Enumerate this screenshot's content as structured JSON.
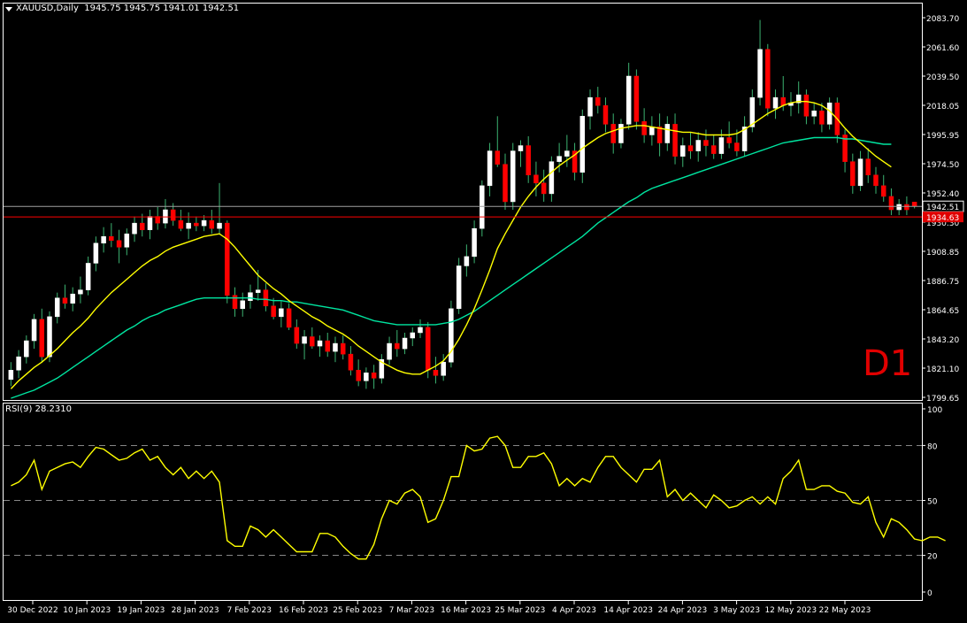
{
  "header": {
    "symbol": "XAUUSD,Daily",
    "ohlc": "1945.75 1945.75 1941.01 1942.51"
  },
  "rsi_label": "RSI(9) 28.2310",
  "timeframe_label": "D1",
  "colors": {
    "background": "#000000",
    "bull": "#ffffff",
    "bear": "#ff0000",
    "ma_fast": "#ffff00",
    "ma_slow": "#00e5a0",
    "rsi": "#ffff00",
    "price_line": "#a0a0a0",
    "red_line": "#ff0000",
    "grid": "#ffffff"
  },
  "price_axis": {
    "ticks": [
      "2083.70",
      "2061.60",
      "2039.50",
      "2018.05",
      "1995.95",
      "1974.50",
      "1952.40",
      "1930.30",
      "1908.85",
      "1886.75",
      "1864.65",
      "1843.20",
      "1821.10",
      "1799.65"
    ],
    "current_price": "1942.51",
    "red_level": "1934.63"
  },
  "rsi_axis": {
    "ticks": [
      "100",
      "80",
      "50",
      "20",
      "0"
    ]
  },
  "date_axis": [
    "30 Dec 2022",
    "10 Jan 2023",
    "19 Jan 2023",
    "28 Jan 2023",
    "7 Feb 2023",
    "16 Feb 2023",
    "25 Feb 2023",
    "7 Mar 2023",
    "16 Mar 2023",
    "25 Mar 2023",
    "4 Apr 2023",
    "14 Apr 2023",
    "24 Apr 2023",
    "3 May 2023",
    "12 May 2023",
    "22 May 2023"
  ],
  "chart_data": [
    {
      "type": "candlestick",
      "title": "XAUUSD,Daily",
      "ylim": [
        1799.65,
        2083.7
      ],
      "candles_ohlc": [
        [
          1813,
          1826,
          1808,
          1820
        ],
        [
          1820,
          1835,
          1814,
          1830
        ],
        [
          1830,
          1846,
          1825,
          1842
        ],
        [
          1842,
          1862,
          1836,
          1858
        ],
        [
          1858,
          1866,
          1826,
          1830
        ],
        [
          1830,
          1864,
          1826,
          1860
        ],
        [
          1860,
          1878,
          1855,
          1874
        ],
        [
          1874,
          1884,
          1866,
          1870
        ],
        [
          1870,
          1882,
          1864,
          1877
        ],
        [
          1877,
          1890,
          1870,
          1880
        ],
        [
          1880,
          1905,
          1876,
          1900
        ],
        [
          1900,
          1920,
          1894,
          1915
        ],
        [
          1915,
          1927,
          1908,
          1920
        ],
        [
          1920,
          1930,
          1912,
          1917
        ],
        [
          1917,
          1925,
          1900,
          1912
        ],
        [
          1912,
          1926,
          1906,
          1922
        ],
        [
          1922,
          1935,
          1916,
          1930
        ],
        [
          1930,
          1937,
          1920,
          1925
        ],
        [
          1925,
          1940,
          1918,
          1935
        ],
        [
          1935,
          1942,
          1925,
          1930
        ],
        [
          1930,
          1948,
          1926,
          1940
        ],
        [
          1940,
          1945,
          1928,
          1932
        ],
        [
          1932,
          1940,
          1924,
          1926
        ],
        [
          1926,
          1938,
          1918,
          1930
        ],
        [
          1930,
          1935,
          1924,
          1928
        ],
        [
          1928,
          1936,
          1924,
          1932
        ],
        [
          1932,
          1940,
          1922,
          1926
        ],
        [
          1926,
          1960,
          1922,
          1930
        ],
        [
          1930,
          1932,
          1870,
          1876
        ],
        [
          1876,
          1882,
          1860,
          1866
        ],
        [
          1866,
          1878,
          1860,
          1872
        ],
        [
          1872,
          1884,
          1866,
          1878
        ],
        [
          1878,
          1895,
          1872,
          1880
        ],
        [
          1880,
          1885,
          1864,
          1868
        ],
        [
          1868,
          1874,
          1858,
          1860
        ],
        [
          1860,
          1872,
          1852,
          1866
        ],
        [
          1866,
          1870,
          1850,
          1852
        ],
        [
          1852,
          1858,
          1836,
          1840
        ],
        [
          1840,
          1850,
          1828,
          1845
        ],
        [
          1845,
          1852,
          1836,
          1838
        ],
        [
          1838,
          1846,
          1830,
          1842
        ],
        [
          1842,
          1848,
          1830,
          1834
        ],
        [
          1834,
          1845,
          1826,
          1840
        ],
        [
          1840,
          1846,
          1828,
          1832
        ],
        [
          1832,
          1838,
          1816,
          1820
        ],
        [
          1820,
          1828,
          1808,
          1812
        ],
        [
          1812,
          1822,
          1806,
          1818
        ],
        [
          1818,
          1824,
          1806,
          1814
        ],
        [
          1814,
          1832,
          1810,
          1828
        ],
        [
          1828,
          1845,
          1824,
          1840
        ],
        [
          1840,
          1850,
          1830,
          1836
        ],
        [
          1836,
          1848,
          1832,
          1844
        ],
        [
          1844,
          1852,
          1838,
          1848
        ],
        [
          1848,
          1858,
          1844,
          1852
        ],
        [
          1852,
          1856,
          1814,
          1820
        ],
        [
          1820,
          1830,
          1810,
          1816
        ],
        [
          1816,
          1832,
          1812,
          1826
        ],
        [
          1826,
          1872,
          1822,
          1866
        ],
        [
          1866,
          1904,
          1862,
          1898
        ],
        [
          1898,
          1914,
          1890,
          1905
        ],
        [
          1905,
          1932,
          1900,
          1926
        ],
        [
          1926,
          1962,
          1920,
          1958
        ],
        [
          1958,
          1990,
          1950,
          1984
        ],
        [
          1984,
          2010,
          1972,
          1974
        ],
        [
          1974,
          1982,
          1940,
          1946
        ],
        [
          1946,
          1990,
          1940,
          1984
        ],
        [
          1984,
          1992,
          1972,
          1988
        ],
        [
          1988,
          1995,
          1960,
          1966
        ],
        [
          1966,
          1976,
          1950,
          1960
        ],
        [
          1960,
          1970,
          1946,
          1952
        ],
        [
          1952,
          1980,
          1946,
          1976
        ],
        [
          1976,
          1990,
          1968,
          1980
        ],
        [
          1980,
          1996,
          1972,
          1984
        ],
        [
          1984,
          1990,
          1962,
          1968
        ],
        [
          1968,
          2015,
          1960,
          2010
        ],
        [
          2010,
          2030,
          2000,
          2024
        ],
        [
          2024,
          2032,
          2012,
          2018
        ],
        [
          2018,
          2024,
          1998,
          2004
        ],
        [
          2004,
          2012,
          1982,
          1990
        ],
        [
          1990,
          2008,
          1986,
          2004
        ],
        [
          2004,
          2050,
          2000,
          2040
        ],
        [
          2040,
          2045,
          2000,
          2006
        ],
        [
          2006,
          2016,
          1990,
          1996
        ],
        [
          1996,
          2010,
          1988,
          2002
        ],
        [
          2002,
          2012,
          1980,
          1990
        ],
        [
          1990,
          2010,
          1984,
          2004
        ],
        [
          2004,
          2012,
          1974,
          1980
        ],
        [
          1980,
          1994,
          1972,
          1988
        ],
        [
          1988,
          1998,
          1978,
          1984
        ],
        [
          1984,
          1998,
          1976,
          1992
        ],
        [
          1992,
          2000,
          1980,
          1988
        ],
        [
          1988,
          1996,
          1978,
          1982
        ],
        [
          1982,
          2000,
          1978,
          1994
        ],
        [
          1994,
          2006,
          1986,
          1990
        ],
        [
          1990,
          2000,
          1980,
          1984
        ],
        [
          1984,
          2010,
          1980,
          2002
        ],
        [
          2002,
          2030,
          1998,
          2024
        ],
        [
          2024,
          2082,
          2018,
          2060
        ],
        [
          2060,
          2064,
          2010,
          2016
        ],
        [
          2016,
          2030,
          2008,
          2024
        ],
        [
          2024,
          2040,
          2014,
          2018
        ],
        [
          2018,
          2028,
          2010,
          2020
        ],
        [
          2020,
          2036,
          2012,
          2026
        ],
        [
          2026,
          2030,
          2004,
          2010
        ],
        [
          2010,
          2020,
          2004,
          2014
        ],
        [
          2014,
          2020,
          1998,
          2004
        ],
        [
          2004,
          2024,
          2000,
          2020
        ],
        [
          2020,
          2024,
          1990,
          1996
        ],
        [
          1996,
          2000,
          1968,
          1976
        ],
        [
          1976,
          1982,
          1952,
          1958
        ],
        [
          1958,
          1984,
          1954,
          1978
        ],
        [
          1978,
          1986,
          1960,
          1966
        ],
        [
          1966,
          1972,
          1952,
          1958
        ],
        [
          1958,
          1966,
          1946,
          1950
        ],
        [
          1950,
          1956,
          1936,
          1940
        ],
        [
          1940,
          1948,
          1936,
          1944
        ],
        [
          1944,
          1950,
          1936,
          1940
        ],
        [
          1945.75,
          1945.75,
          1941.01,
          1942.51
        ]
      ],
      "ma_fast": [
        1806,
        1812,
        1817,
        1822,
        1826,
        1831,
        1836,
        1842,
        1848,
        1853,
        1859,
        1866,
        1872,
        1878,
        1883,
        1888,
        1893,
        1898,
        1902,
        1905,
        1909,
        1912,
        1914,
        1916,
        1918,
        1920,
        1921,
        1922,
        1918,
        1912,
        1905,
        1898,
        1891,
        1886,
        1881,
        1877,
        1872,
        1868,
        1864,
        1860,
        1857,
        1853,
        1850,
        1847,
        1843,
        1838,
        1834,
        1830,
        1826,
        1823,
        1820,
        1818,
        1817,
        1817,
        1820,
        1823,
        1827,
        1834,
        1843,
        1854,
        1866,
        1880,
        1895,
        1911,
        1922,
        1932,
        1942,
        1950,
        1957,
        1963,
        1968,
        1973,
        1977,
        1981,
        1986,
        1990,
        1994,
        1997,
        1999,
        2001,
        2002,
        2003,
        2003,
        2002,
        2001,
        2000,
        1999,
        1998,
        1998,
        1997,
        1996,
        1996,
        1996,
        1996,
        1997,
        2000,
        2004,
        2008,
        2012,
        2015,
        2018,
        2020,
        2021,
        2021,
        2020,
        2018,
        2014,
        2008,
        2001,
        1995,
        1990,
        1985,
        1980,
        1976,
        1972
      ],
      "ma_slow": [
        1799,
        1801,
        1803,
        1805,
        1808,
        1811,
        1814,
        1818,
        1822,
        1826,
        1830,
        1834,
        1838,
        1842,
        1846,
        1850,
        1853,
        1857,
        1860,
        1862,
        1865,
        1867,
        1869,
        1871,
        1873,
        1874,
        1874,
        1874,
        1874,
        1874,
        1874,
        1874,
        1873,
        1873,
        1872,
        1872,
        1871,
        1871,
        1870,
        1869,
        1868,
        1867,
        1866,
        1865,
        1863,
        1861,
        1859,
        1857,
        1856,
        1855,
        1854,
        1854,
        1854,
        1854,
        1854,
        1854,
        1855,
        1856,
        1858,
        1861,
        1864,
        1868,
        1872,
        1876,
        1880,
        1884,
        1888,
        1892,
        1896,
        1900,
        1904,
        1908,
        1912,
        1916,
        1920,
        1925,
        1930,
        1934,
        1938,
        1942,
        1946,
        1949,
        1953,
        1956,
        1958,
        1960,
        1962,
        1964,
        1966,
        1968,
        1970,
        1972,
        1974,
        1976,
        1978,
        1980,
        1982,
        1984,
        1986,
        1988,
        1990,
        1991,
        1992,
        1993,
        1994,
        1994,
        1994,
        1994,
        1993,
        1993,
        1992,
        1991,
        1990,
        1989,
        1989
      ]
    },
    {
      "type": "line",
      "title": "RSI(9) 28.2310",
      "ylim": [
        0,
        100
      ],
      "levels": [
        80,
        50,
        20
      ],
      "series": [
        {
          "name": "RSI(9)",
          "values": [
            58,
            60,
            64,
            72,
            56,
            66,
            68,
            70,
            71,
            68,
            74,
            79,
            78,
            75,
            72,
            73,
            76,
            78,
            72,
            74,
            68,
            64,
            68,
            62,
            66,
            62,
            66,
            60,
            28,
            25,
            25,
            36,
            34,
            30,
            34,
            30,
            26,
            22,
            22,
            22,
            32,
            32,
            30,
            25,
            21,
            18,
            18,
            26,
            40,
            50,
            48,
            54,
            56,
            52,
            38,
            40,
            50,
            63,
            63,
            80,
            77,
            78,
            84,
            85,
            80,
            68,
            68,
            74,
            74,
            76,
            70,
            58,
            62,
            58,
            62,
            60,
            68,
            74,
            74,
            68,
            64,
            60,
            67,
            67,
            72,
            52,
            56,
            50,
            54,
            50,
            46,
            53,
            50,
            46,
            47,
            50,
            52,
            48,
            52,
            48,
            62,
            66,
            72,
            56,
            56,
            58,
            58,
            55,
            54,
            49,
            48,
            52,
            38,
            30,
            40,
            38,
            34,
            29,
            28,
            30,
            30,
            28
          ]
        }
      ]
    }
  ]
}
